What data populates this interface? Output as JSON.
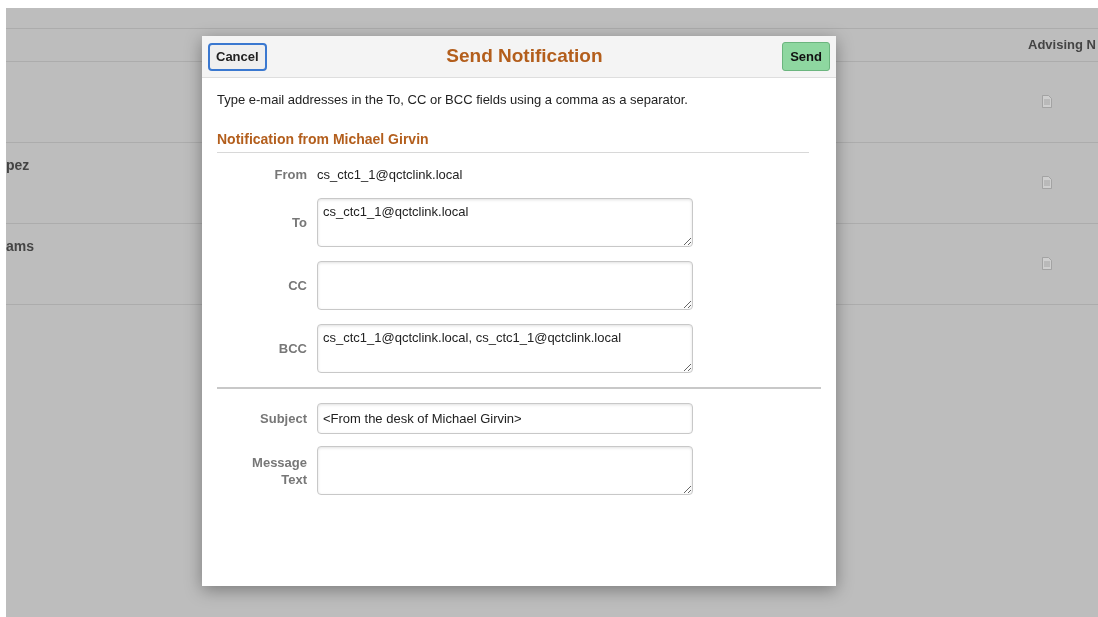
{
  "background_table": {
    "header": {
      "column_2": "Advising N"
    },
    "rows": [
      {},
      {
        "column_1": "pez"
      },
      {
        "column_1": "ams"
      }
    ]
  },
  "dialog": {
    "title": "Send Notification",
    "cancel": "Cancel",
    "send": "Send",
    "instructions": "Type e-mail addresses in the To, CC or BCC fields using a comma as a separator.",
    "section": "Notification from Michael Girvin",
    "address_fields": [
      {
        "kind": "static",
        "label": "From",
        "value": "cs_ctc1_1@qctclink.local"
      },
      {
        "kind": "textarea",
        "label": "To",
        "value": "cs_ctc1_1@qctclink.local"
      },
      {
        "kind": "textarea",
        "label": "CC"
      },
      {
        "kind": "textarea",
        "label": "BCC",
        "value": "cs_ctc1_1@qctclink.local, cs_ctc1_1@qctclink.local"
      }
    ],
    "message_fields": [
      {
        "kind": "input",
        "label": "Subject",
        "value": "<From the desk of Michael Girvin>"
      },
      {
        "kind": "textarea",
        "label": "Message Text"
      }
    ]
  }
}
